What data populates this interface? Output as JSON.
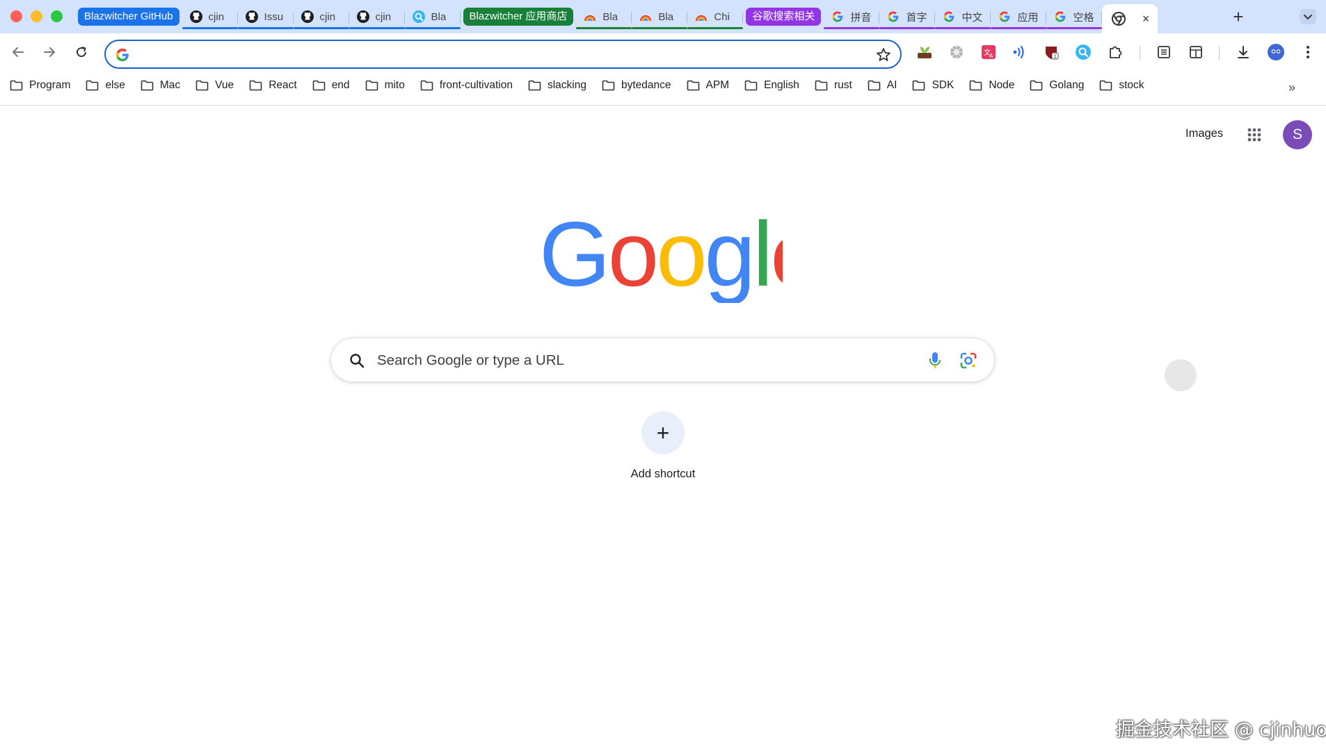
{
  "window": {
    "traffic_lights": [
      "close",
      "minimize",
      "zoom"
    ]
  },
  "tabs": [
    {
      "kind": "group",
      "label": "Blazwitcher GitHub",
      "color": "#1a73e8"
    },
    {
      "kind": "tab",
      "label": "cjin",
      "icon": "github-icon"
    },
    {
      "kind": "tab",
      "label": "Issu",
      "icon": "github-icon"
    },
    {
      "kind": "tab",
      "label": "cjin",
      "icon": "github-icon"
    },
    {
      "kind": "tab",
      "label": "cjin",
      "icon": "github-icon"
    },
    {
      "kind": "tab",
      "label": "Bla",
      "icon": "search-badge-icon"
    },
    {
      "kind": "group",
      "label": "Blazwitcher 应用商店",
      "color": "#188038"
    },
    {
      "kind": "tab",
      "label": "Bla",
      "icon": "rainbow-icon"
    },
    {
      "kind": "tab",
      "label": "Bla",
      "icon": "rainbow-icon"
    },
    {
      "kind": "tab",
      "label": "Chi",
      "icon": "rainbow-icon"
    },
    {
      "kind": "group",
      "label": "谷歌搜索相关",
      "color": "#9334e6"
    },
    {
      "kind": "tab",
      "label": "拼音",
      "icon": "google-g-icon"
    },
    {
      "kind": "tab",
      "label": "首字",
      "icon": "google-g-icon"
    },
    {
      "kind": "tab",
      "label": "中文",
      "icon": "google-g-icon"
    },
    {
      "kind": "tab",
      "label": "应用",
      "icon": "google-g-icon"
    },
    {
      "kind": "tab",
      "label": "空格",
      "icon": "google-g-icon"
    }
  ],
  "active_tab": {
    "icon": "chrome-icon",
    "close": "×"
  },
  "new_tab_label": "+",
  "omnibox": {
    "value": "",
    "placeholder": ""
  },
  "bookmarks": [
    "Program",
    "else",
    "Mac",
    "Vue",
    "React",
    "end",
    "mito",
    "front-cultivation",
    "slacking",
    "bytedance",
    "APM",
    "English",
    "rust",
    "AI",
    "SDK",
    "Node",
    "Golang",
    "stock"
  ],
  "bookmarks_overflow": "»",
  "header": {
    "images_link": "Images",
    "avatar_letter": "S"
  },
  "search": {
    "placeholder": "Search Google or type a URL"
  },
  "shortcut": {
    "plus": "+",
    "label": "Add shortcut"
  },
  "watermark": "掘金技术社区 @ cjinhuo",
  "colors": {
    "tab_strip": "#d3e3fd",
    "omnibox_border": "#1a5fd0",
    "google_blue": "#4285f4",
    "google_red": "#ea4335",
    "google_yellow": "#fbbc05",
    "google_green": "#34a853",
    "avatar": "#7b4bb8"
  }
}
